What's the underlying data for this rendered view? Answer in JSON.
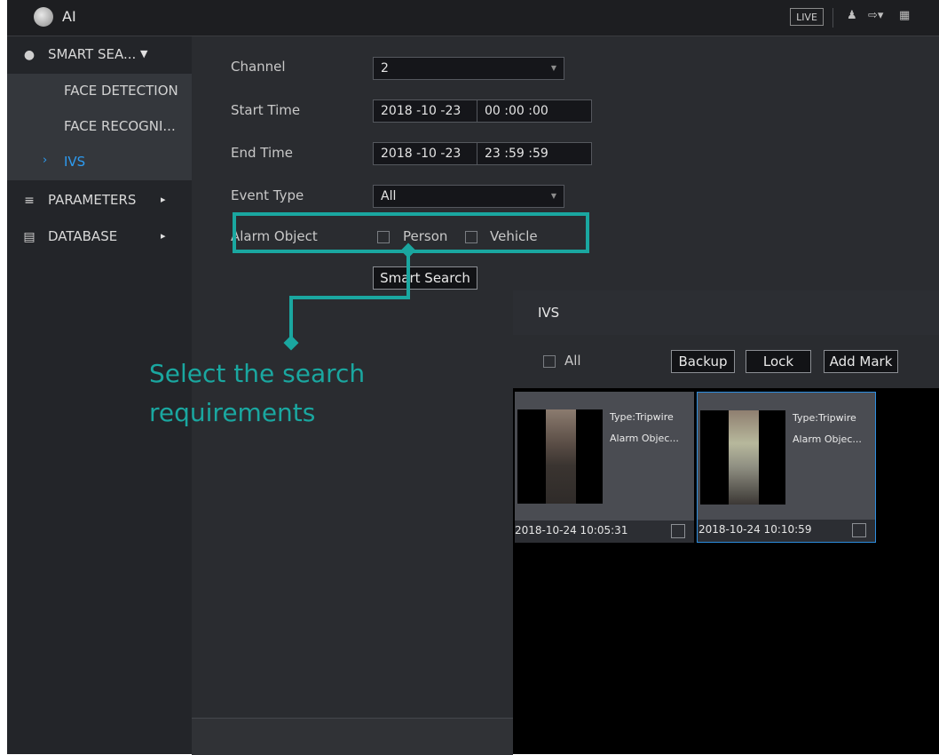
{
  "app": {
    "title": "AI",
    "live_label": "LIVE"
  },
  "sidebar": {
    "smart_search": "SMART SEA...",
    "sub_items": [
      "FACE DETECTION",
      "FACE RECOGNI...",
      "IVS"
    ],
    "parameters": "PARAMETERS",
    "database": "DATABASE"
  },
  "form": {
    "channel_label": "Channel",
    "channel_value": "2",
    "start_label": "Start Time",
    "start_date": "2018 -10 -23",
    "start_time": "00 :00 :00",
    "end_label": "End Time",
    "end_date": "2018 -10 -23",
    "end_time": "23 :59 :59",
    "event_label": "Event Type",
    "event_value": "All",
    "alarm_label": "Alarm Object",
    "person_label": "Person",
    "vehicle_label": "Vehicle",
    "search_button": "Smart Search"
  },
  "callout": {
    "line1": "Select the search",
    "line2": "requirements"
  },
  "ivs": {
    "title": "IVS",
    "all_label": "All",
    "backup": "Backup",
    "lock": "Lock",
    "add_mark": "Add Mark",
    "results": [
      {
        "type": "Type:Tripwire",
        "alarm": "Alarm Objec...",
        "time": "2018-10-24 10:05:31"
      },
      {
        "type": "Type:Tripwire",
        "alarm": "Alarm Objec...",
        "time": "2018-10-24 10:10:59"
      }
    ]
  },
  "colors": {
    "accent_teal": "#1aa7a0",
    "active_blue": "#2d9bf0"
  },
  "icons": [
    "app-logo-icon",
    "smart-search-icon",
    "list-icon",
    "database-icon",
    "user-icon",
    "logout-icon",
    "qrcode-icon"
  ]
}
